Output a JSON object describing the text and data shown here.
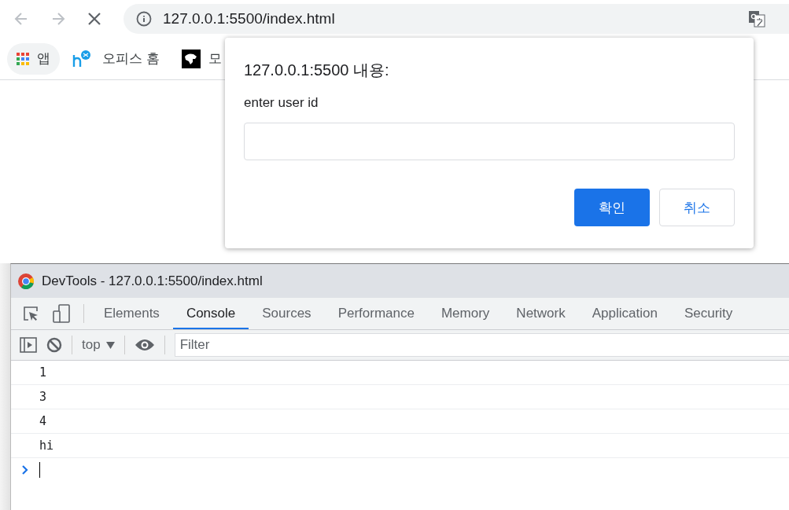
{
  "browser": {
    "address": "127.0.0.1:5500/index.html",
    "bookmarks": [
      {
        "label": "앱",
        "kind": "apps"
      },
      {
        "label": "오피스 홈",
        "kind": "office"
      },
      {
        "label": "모",
        "kind": "dark"
      }
    ]
  },
  "dialog": {
    "title": "127.0.0.1:5500 내용:",
    "message": "enter user id",
    "buttons": [
      {
        "label": "확인",
        "kind": "primary"
      },
      {
        "label": "취소",
        "kind": "secondary"
      }
    ]
  },
  "devtools": {
    "title": "DevTools - 127.0.0.1:5500/index.html",
    "tabs": [
      {
        "label": "Elements",
        "selected": false
      },
      {
        "label": "Console",
        "selected": true
      },
      {
        "label": "Sources",
        "selected": false
      },
      {
        "label": "Performance",
        "selected": false
      },
      {
        "label": "Memory",
        "selected": false
      },
      {
        "label": "Network",
        "selected": false
      },
      {
        "label": "Application",
        "selected": false
      },
      {
        "label": "Security",
        "selected": false
      }
    ],
    "context": "top",
    "filter": {
      "placeholder": "Filter"
    },
    "console_lines": [
      "1",
      "3",
      "4",
      "hi"
    ]
  }
}
